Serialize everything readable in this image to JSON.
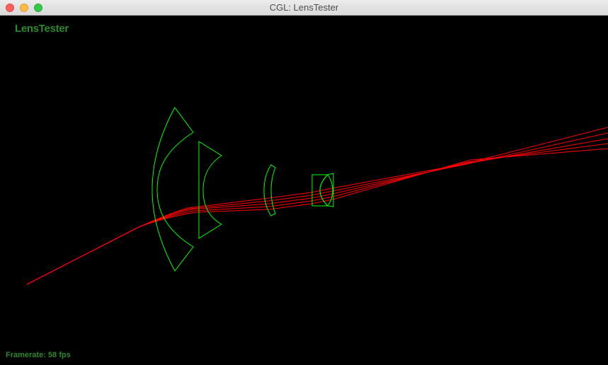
{
  "window": {
    "title": "CGL: LensTester"
  },
  "overlay": {
    "app_name": "LensTester",
    "framerate_label": "Framerate: 58 fps"
  },
  "colors": {
    "lens_outline": "#00ff00",
    "ray": "#ff0000",
    "overlay_text": "#2c8a2c",
    "background": "#000000"
  }
}
